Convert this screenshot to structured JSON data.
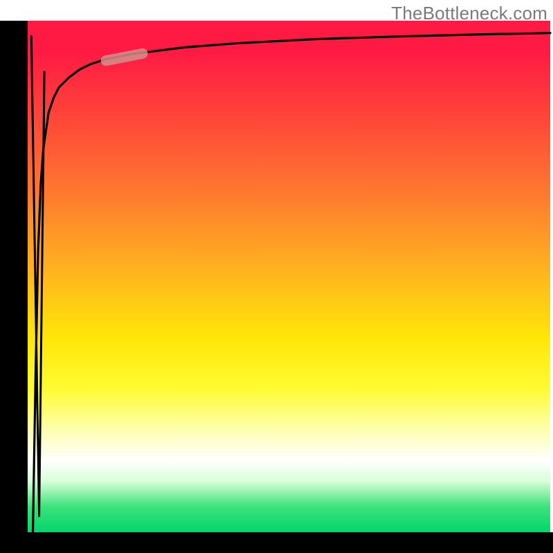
{
  "watermark": "TheBottleneck.com",
  "chart_data": {
    "type": "line",
    "title": "",
    "xlabel": "",
    "ylabel": "",
    "xlim": [
      0,
      100
    ],
    "ylim": [
      0,
      100
    ],
    "grid": false,
    "annotations": [],
    "series": [
      {
        "name": "curve",
        "color": "#000000",
        "x": [
          1,
          1.5,
          2,
          2.5,
          3,
          4,
          5,
          6,
          8,
          10,
          12,
          15,
          20,
          30,
          40,
          55,
          70,
          85,
          100
        ],
        "y": [
          0,
          30,
          55,
          68,
          75,
          82,
          85,
          87,
          89,
          90.5,
          91.5,
          92.5,
          93.5,
          94.8,
          95.6,
          96.4,
          96.9,
          97.3,
          97.6
        ]
      },
      {
        "name": "highlight-segment",
        "color": "#d48f8a",
        "x": [
          15,
          22
        ],
        "y": [
          92.2,
          93.6
        ]
      },
      {
        "name": "inner-dip",
        "color": "#000000",
        "x": [
          0.7,
          2.2,
          3.2
        ],
        "y": [
          97,
          3,
          90
        ]
      }
    ],
    "background_gradient": {
      "direction": "vertical",
      "stops": [
        {
          "pos": 0.0,
          "color": "#ff1a44"
        },
        {
          "pos": 0.34,
          "color": "#ff7a2f"
        },
        {
          "pos": 0.62,
          "color": "#ffe608"
        },
        {
          "pos": 0.8,
          "color": "#fdffb0"
        },
        {
          "pos": 0.86,
          "color": "#ffffff"
        },
        {
          "pos": 0.95,
          "color": "#3de27b"
        },
        {
          "pos": 1.0,
          "color": "#00d66a"
        }
      ]
    }
  }
}
